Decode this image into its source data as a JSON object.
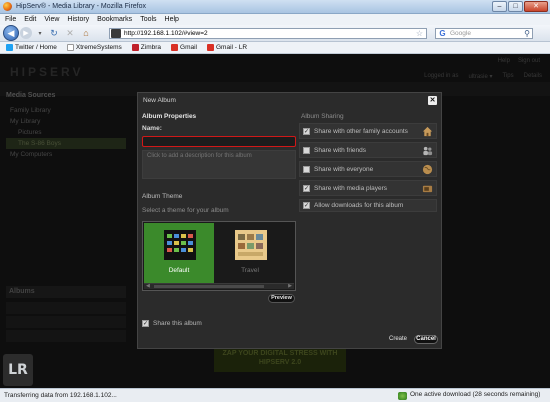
{
  "window": {
    "title": "HipServ® - Media Library - Mozilla Firefox",
    "buttons": [
      "–",
      "□",
      "✕"
    ]
  },
  "menu": [
    "File",
    "Edit",
    "View",
    "History",
    "Bookmarks",
    "Tools",
    "Help"
  ],
  "nav": {
    "url": "http://192.168.1.102/#view=2",
    "search_placeholder": "Google"
  },
  "bookmarks": [
    {
      "label": "Twitter / Home",
      "icon": "twitter-icon",
      "color": "#1da1f2"
    },
    {
      "label": "XtremeSystems",
      "icon": "page-icon",
      "color": "#ffffff"
    },
    {
      "label": "Zimbra",
      "icon": "zimbra-icon",
      "color": "#c0202a"
    },
    {
      "label": "Gmail",
      "icon": "gmail-icon",
      "color": "#d93025"
    },
    {
      "label": "Gmail - LR",
      "icon": "gmail-icon",
      "color": "#d93025"
    }
  ],
  "app": {
    "logo": "HIPSERV",
    "top_links": [
      "Help",
      "Sign out"
    ],
    "top_links2": [
      "Logged in as",
      "ultrasie ▾",
      "Tips",
      "Details"
    ],
    "sidebar": {
      "media_sources": "Media Sources",
      "items": [
        "Family Library",
        "My Library",
        "Pictures",
        "The S-86 Boys",
        "My Computers"
      ],
      "albums": "Albums"
    },
    "banner": "ZAP YOUR DIGITAL STRESS WITH HIPSERV 2.0"
  },
  "dialog": {
    "title": "New Album",
    "close": "✕",
    "properties": {
      "title": "Album Properties",
      "name_label": "Name:",
      "name_value": "",
      "description_placeholder": "Click to add a description for this album"
    },
    "sharing": {
      "title": "Album Sharing",
      "options": [
        {
          "label": "Share with other family accounts",
          "checked": true,
          "icon": "house-icon"
        },
        {
          "label": "Share with friends",
          "checked": false,
          "icon": "people-icon"
        },
        {
          "label": "Share with everyone",
          "checked": false,
          "icon": "globe-icon"
        },
        {
          "label": "Share with media players",
          "checked": true,
          "icon": "media-player-icon"
        },
        {
          "label": "Allow downloads for this album",
          "checked": true,
          "icon": ""
        }
      ]
    },
    "theme": {
      "title": "Album Theme",
      "subtitle": "Select a theme for your album",
      "options": [
        {
          "label": "Default",
          "selected": true
        },
        {
          "label": "Travel",
          "selected": false
        }
      ],
      "preview_button": "Preview"
    },
    "share_this_album": {
      "label": "Share this album",
      "checked": true
    },
    "create_button": "Create",
    "cancel_button": "Cancel"
  },
  "status": {
    "left": "Transferring data from 192.168.1.102...",
    "right": "One active download (28 seconds remaining)"
  },
  "colors": {
    "accent_green": "#3b8a2b",
    "error_red": "#d01818",
    "dialog_bg": "#2b2b2b"
  }
}
